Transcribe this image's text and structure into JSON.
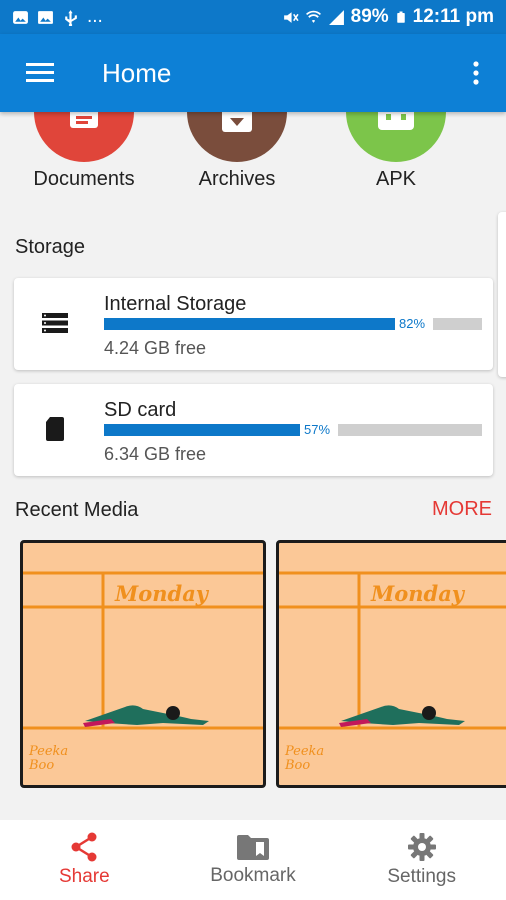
{
  "status_bar": {
    "battery": "89%",
    "time": "12:11 pm",
    "notifications_more": "..."
  },
  "app_bar": {
    "title": "Home"
  },
  "categories": [
    {
      "label": "Documents",
      "color": "#e0453a"
    },
    {
      "label": "Archives",
      "color": "#7a4d3c"
    },
    {
      "label": "APK",
      "color": "#7cc54a"
    }
  ],
  "storage": {
    "title": "Storage",
    "items": [
      {
        "name": "Internal Storage",
        "percent_label": "82%",
        "used_fraction": 0.82,
        "free": "4.24 GB free",
        "icon": "storage-icon"
      },
      {
        "name": "SD card",
        "percent_label": "57%",
        "used_fraction": 0.57,
        "free": "6.34 GB free",
        "icon": "sd-card-icon"
      }
    ]
  },
  "recent_media": {
    "title": "Recent Media",
    "more_label": "MORE",
    "items": [
      {
        "heading": "Monday",
        "caption": "Peeka Boo"
      },
      {
        "heading": "Monday",
        "caption": "Peeka Boo"
      }
    ]
  },
  "bottom_nav": {
    "items": [
      {
        "label": "Share",
        "icon": "share-icon",
        "active": true
      },
      {
        "label": "Bookmark",
        "icon": "bookmark-icon",
        "active": false
      },
      {
        "label": "Settings",
        "icon": "gear-icon",
        "active": false
      }
    ]
  },
  "colors": {
    "primary": "#0d80d6",
    "accent": "#e53935",
    "bar": "#0d78c9"
  }
}
